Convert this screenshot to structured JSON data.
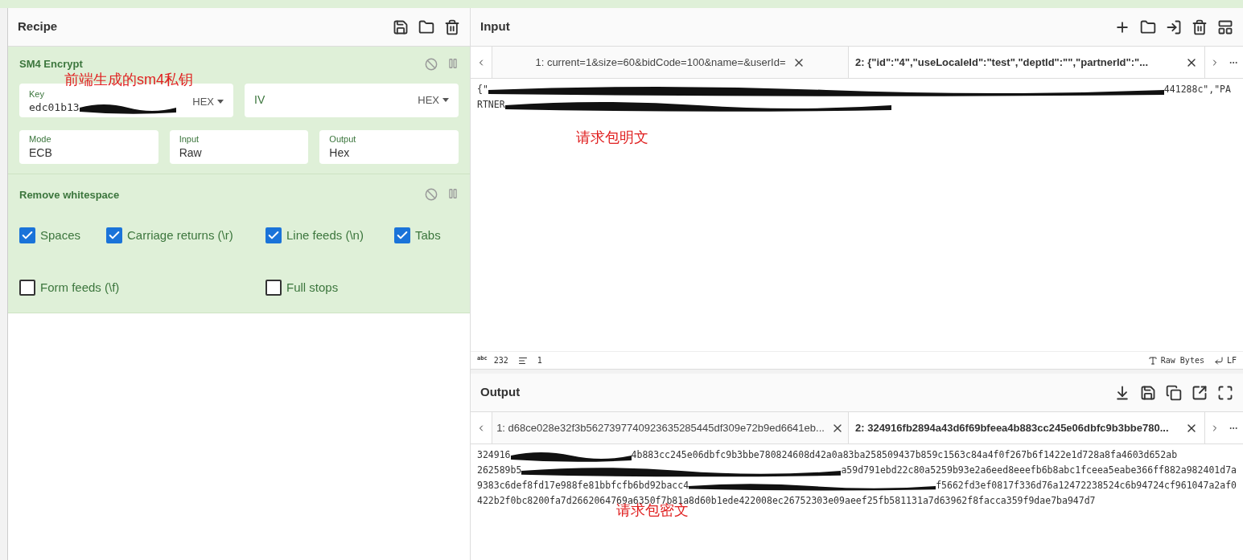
{
  "recipe": {
    "title": "Recipe",
    "sm4": {
      "title": "SM4 Encrypt",
      "key": {
        "label": "Key",
        "value": "edc01b13",
        "redacted": true,
        "format": "HEX"
      },
      "iv": {
        "placeholder": "IV",
        "format": "HEX"
      },
      "fields": [
        {
          "label": "Mode",
          "value": "ECB"
        },
        {
          "label": "Input",
          "value": "Raw"
        },
        {
          "label": "Output",
          "value": "Hex"
        }
      ]
    },
    "whitespace": {
      "title": "Remove whitespace",
      "options": [
        {
          "label": "Spaces",
          "checked": true
        },
        {
          "label": "Carriage returns (\\r)",
          "checked": true
        },
        {
          "label": "Line feeds (\\n)",
          "checked": true
        },
        {
          "label": "Tabs",
          "checked": true
        },
        {
          "label": "Form feeds (\\f)",
          "checked": false
        },
        {
          "label": "Full stops",
          "checked": false
        }
      ]
    }
  },
  "input": {
    "title": "Input",
    "tabs": [
      {
        "label": "1: current=1&size=60&bidCode=100&name=&userId=",
        "selected": false
      },
      {
        "label": "2: {\"id\":\"4\",\"useLocaleId\":\"test\",\"deptId\":\"\",\"partnerId\":\"...",
        "selected": true
      }
    ],
    "lines": [
      [
        {
          "kind": "text",
          "text": "{\""
        },
        {
          "kind": "redacted"
        },
        {
          "kind": "text",
          "text": "441288c\",\"PA"
        }
      ],
      [
        {
          "kind": "text",
          "text": "RTNER"
        },
        {
          "kind": "redacted"
        }
      ]
    ],
    "status": {
      "chars_icon": "abc",
      "chars": "232",
      "lines": "1",
      "encoding": "Raw Bytes",
      "eol": "LF"
    }
  },
  "output": {
    "title": "Output",
    "tabs": [
      {
        "label": "1: d68ce028e32f3b5627397740923635285445df309e72b9ed6641eb...",
        "selected": false
      },
      {
        "label": "2: 324916fb2894a43d6f69bfeea4b883cc245e06dbfc9b3bbe780...",
        "selected": true
      }
    ],
    "lines": [
      [
        {
          "kind": "text",
          "text": "324916"
        },
        {
          "kind": "redacted"
        },
        {
          "kind": "text",
          "text": "4b883cc245e06dbfc9b3bbe780824608d42a0a83ba258509437b859c1563c84a4f0f267b6f1422e1d728a8fa4603d652ab"
        }
      ],
      [
        {
          "kind": "text",
          "text": "262589b5"
        },
        {
          "kind": "redacted"
        },
        {
          "kind": "text",
          "text": "a59d791ebd22c80a5259b93e2a6eed8eeefb6b8abc1fceea5eabe366ff882a982401d7a"
        }
      ],
      [
        {
          "kind": "text",
          "text": "9383c6def8fd17e988fe81bbfcfb6bd92bacc4"
        },
        {
          "kind": "redacted"
        },
        {
          "kind": "text",
          "text": "f5662fd3ef0817f336d76a12472238524c6b94724cf961047a2af0"
        }
      ],
      [
        {
          "kind": "text",
          "text": "422b2f0bc8200fa7d2662064769a6350f7b81a8d60b1ede422008ec26752303e09aeef25fb581131a7d63962f8facca359f9dae7ba947d7"
        }
      ]
    ]
  },
  "annotations": [
    {
      "text": "前端生成的sm4私钥"
    },
    {
      "text": "请求包明文"
    },
    {
      "text": "请求包密文"
    }
  ]
}
